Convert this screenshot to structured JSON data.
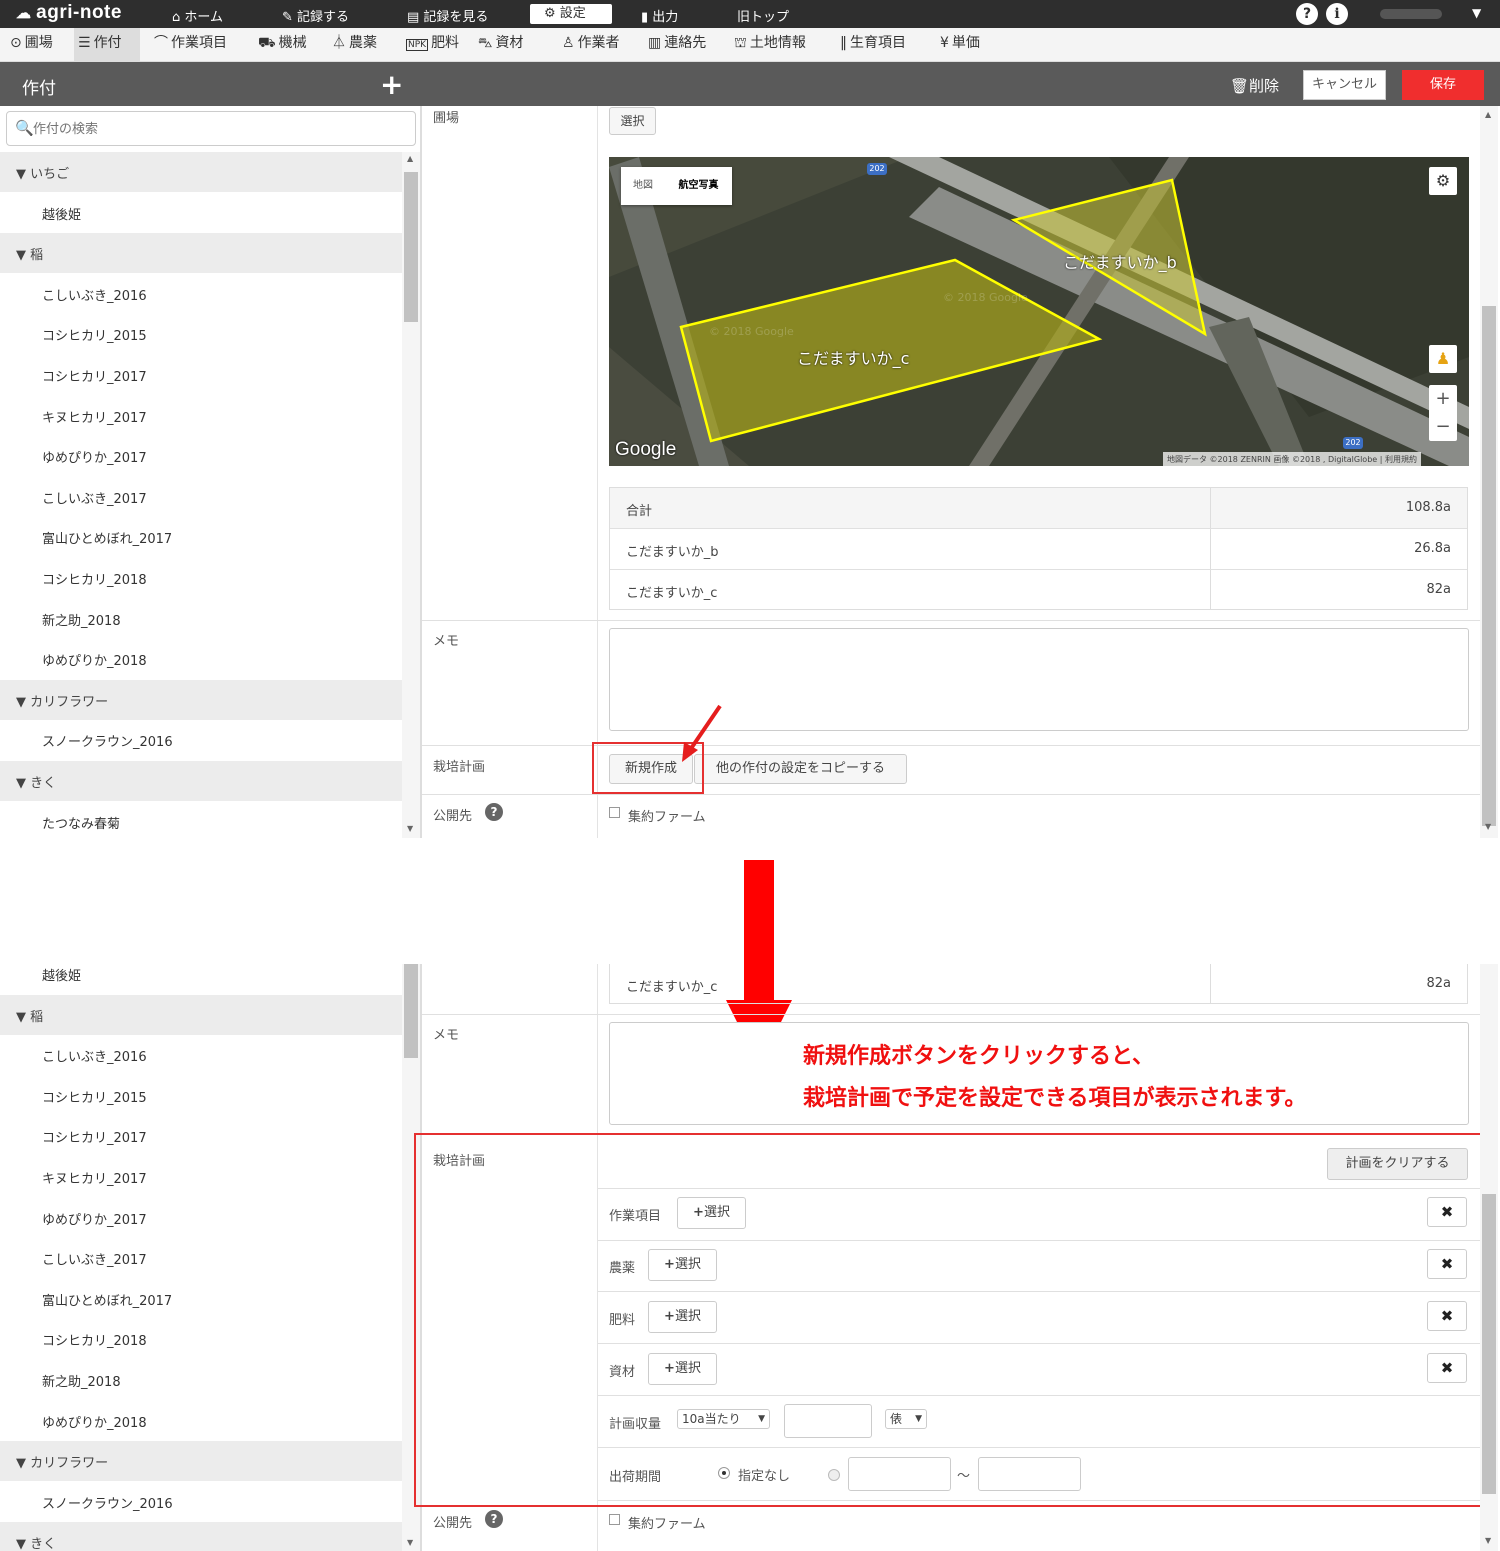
{
  "topbar": {
    "logo": "agri-note",
    "nav": [
      "ホーム",
      "記録する",
      "記録を見る",
      "設定",
      "出力",
      "旧トップ"
    ],
    "help": "?",
    "info": "i"
  },
  "subnav": [
    "圃場",
    "作付",
    "作業項目",
    "機械",
    "農薬",
    "肥料",
    "資材",
    "作業者",
    "連絡先",
    "土地情報",
    "生育項目",
    "単価"
  ],
  "header": {
    "title": "作付",
    "delete": "削除",
    "cancel": "キャンセル",
    "save": "保存"
  },
  "search": {
    "placeholder": "作付の検索"
  },
  "list1": [
    {
      "g": "▼ いちご"
    },
    {
      "i": "越後姫"
    },
    {
      "g": "▼ 稲"
    },
    {
      "i": "こしいぶき_2016"
    },
    {
      "i": "コシヒカリ_2015"
    },
    {
      "i": "コシヒカリ_2017"
    },
    {
      "i": "キヌヒカリ_2017"
    },
    {
      "i": "ゆめぴりか_2017"
    },
    {
      "i": "こしいぶき_2017"
    },
    {
      "i": "富山ひとめぼれ_2017"
    },
    {
      "i": "コシヒカリ_2018"
    },
    {
      "i": "新之助_2018"
    },
    {
      "i": "ゆめぴりか_2018"
    },
    {
      "g": "▼ カリフラワー"
    },
    {
      "i": "スノークラウン_2016"
    },
    {
      "g": "▼ きく"
    },
    {
      "i": "たつなみ春菊"
    }
  ],
  "list2": [
    {
      "i": "越後姫"
    },
    {
      "g": "▼ 稲"
    },
    {
      "i": "こしいぶき_2016"
    },
    {
      "i": "コシヒカリ_2015"
    },
    {
      "i": "コシヒカリ_2017"
    },
    {
      "i": "キヌヒカリ_2017"
    },
    {
      "i": "ゆめぴりか_2017"
    },
    {
      "i": "こしいぶき_2017"
    },
    {
      "i": "富山ひとめぼれ_2017"
    },
    {
      "i": "コシヒカリ_2018"
    },
    {
      "i": "新之助_2018"
    },
    {
      "i": "ゆめぴりか_2018"
    },
    {
      "g": "▼ カリフラワー"
    },
    {
      "i": "スノークラウン_2016"
    },
    {
      "g": "▼ きく"
    }
  ],
  "form": {
    "field_label": "圃場",
    "select": "選択",
    "map_tab": "地図",
    "sat_tab": "航空写真",
    "field_b": "こだますいか_b",
    "field_c": "こだますいか_c",
    "google": "Google",
    "credits": "地図データ ©2018 ZENRIN 画像 ©2018 , DigitalGlobe",
    "terms": "利用規約",
    "road": "202",
    "watermark": "© 2018 Google",
    "total_label": "合計",
    "total": "108.8a",
    "b_area": "26.8a",
    "c_area": "82a",
    "memo": "メモ",
    "plan": "栽培計画",
    "new": "新規作成",
    "copy": "他の作付の設定をコピーする",
    "public": "公開先",
    "public_opt": "集約ファーム"
  },
  "callout": {
    "line1": "新規作成ボタンをクリックすると、",
    "line2": "栽培計画で予定を設定できる項目が表示されます。"
  },
  "plan": {
    "clear": "計画をクリアする",
    "rows": [
      "作業項目",
      "農薬",
      "肥料",
      "資材"
    ],
    "select": "選択",
    "yield": "計画収量",
    "per": "10a当たり",
    "unit": "俵",
    "ship": "出荷期間",
    "none": "指定なし",
    "tilde": "〜"
  },
  "colors": {
    "accent": "#f02e2e",
    "polygon": "#e8e600"
  }
}
